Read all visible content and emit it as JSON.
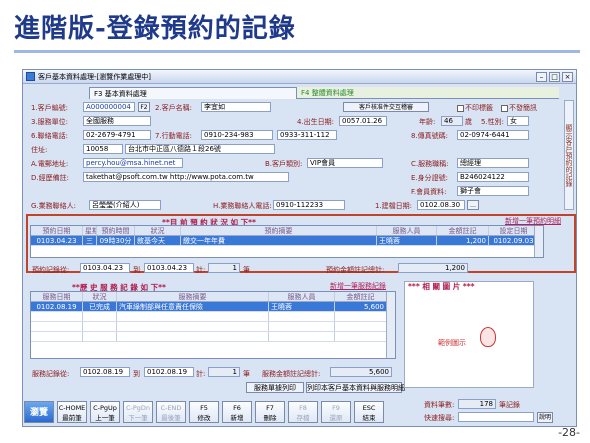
{
  "slide": {
    "title": "進階版-登錄預約的記錄",
    "page": "-28-"
  },
  "window": {
    "title": "客戶基本資料處理-[瀏覽作業處理中]"
  },
  "tabs": {
    "main": "F3 基本資料處理",
    "other": "F4 整體資料處理"
  },
  "side_tab": "顯示客戶預約的記錄",
  "form": {
    "cust_no_label": "1.客戶編號:",
    "cust_no": "A000000004",
    "f2": "F2",
    "cust_name_label": "2.客戶名稱:",
    "cust_name": "李宜如",
    "compare_btn": "客戶核准件交互稽審",
    "cb_print": "不印標籤",
    "cb_birthday": "不發簡訊",
    "unit_label": "3.服務單位:",
    "unit": "全國服務",
    "birth_label": "4.出生日期:",
    "birth": "0057.01.26",
    "age_label": "年齡:",
    "age": "46",
    "age_unit": "歲",
    "gender_label": "5.性別:",
    "gender": "女",
    "phone_label": "6.聯絡電話:",
    "phone": "02-2679-4791",
    "mobile_label": "7.行動電話:",
    "mobile": "0910-234-983",
    "mobile2": "0933-311-112",
    "fax_label": "8.傳真號碼:",
    "fax": "02-0974-6441",
    "addr_label": "住址:",
    "zip": "10058",
    "addr": "台北市中正區八德路１段26號",
    "email_label": "A.電郵地址:",
    "email": "percy.hou@msa.hinet.net",
    "type_label": "B.客戶類別:",
    "type": "VIP會員",
    "title_label": "C.服務職稱:",
    "title": "總經理",
    "note_label": "D.經歷備註:",
    "note": "takethat@psoft.com.tw  http://www.pota.com.tw",
    "id_label": "E.身分證號:",
    "id": "B246024122",
    "job_label": "F.會員資料:",
    "job": "獅子會",
    "contact_label": "G.業務聯絡人:",
    "contact": "呂瑩瑩(介紹人)",
    "contact_phone_label": "H.業務聯絡人電話:",
    "contact_phone": "0910-112233",
    "date_label": "1.建檔日期:",
    "date": "0102.08.30"
  },
  "appt": {
    "heading": "**目 前 預 約 狀 況 如 下**",
    "add_link": "新增一筆預約明細",
    "headers": [
      "預約日期",
      "星期",
      "預約時間",
      "狀況",
      "預約摘要",
      "服務人員",
      "金額註記",
      "設定日期"
    ],
    "rows": [
      [
        "0103.04.23",
        "三",
        "09時30分",
        "敘基今天",
        "繳交一年年費",
        "王曉蓉",
        "1,200",
        "0102.09.03"
      ]
    ],
    "from_label": "預約記錄從:",
    "from": "0103.04.23",
    "to_label": "到",
    "to": "0103.04.23",
    "count_label": "計:",
    "count": "1",
    "count_unit": "筆",
    "amount_label": "預約金額註記總計:",
    "amount": "1,200"
  },
  "hist": {
    "heading": "**歷 史 服 務 記 錄 如 下**",
    "add_link": "新增一筆服務紀錄",
    "headers": [
      "服務日期",
      "狀況",
      "服務摘要",
      "服務人員",
      "金額註記"
    ],
    "rows": [
      [
        "0102.08.19",
        "已完成",
        "汽車綠制部與任意責任保險",
        "王曉蓉",
        "5,600"
      ]
    ],
    "from_label": "服務記錄從:",
    "from": "0102.08.19",
    "to_label": "到",
    "to": "0102.08.19",
    "count_label": "計:",
    "count": "1",
    "count_unit": "筆",
    "amount_label": "服務金額註記總計:",
    "amount": "5,600",
    "print_btn": "服務單據列印",
    "print_all_btn": "列印本客戶基本資料與服務明細"
  },
  "photo": {
    "heading": "***     相 關 圖 片     ***",
    "caption": "範例圖示"
  },
  "toolbar": [
    {
      "l1": "瀏覽",
      "l2": ""
    },
    {
      "l1": "C-HOME",
      "l2": "最前筆"
    },
    {
      "l1": "C-PgUp",
      "l2": "上一筆"
    },
    {
      "l1": "C-PgDn",
      "l2": "下一筆"
    },
    {
      "l1": "C-END",
      "l2": "最後筆"
    },
    {
      "l1": "F5",
      "l2": "修改"
    },
    {
      "l1": "F6",
      "l2": "新增"
    },
    {
      "l1": "F7",
      "l2": "刪除"
    },
    {
      "l1": "F8",
      "l2": "存檔"
    },
    {
      "l1": "F9",
      "l2": "還原"
    },
    {
      "l1": "ESC",
      "l2": "結束"
    }
  ],
  "status": {
    "count_label": "資料筆數:",
    "count": "178",
    "count_unit": "筆記錄",
    "search_label": "快速搜尋:",
    "help": "說明"
  }
}
